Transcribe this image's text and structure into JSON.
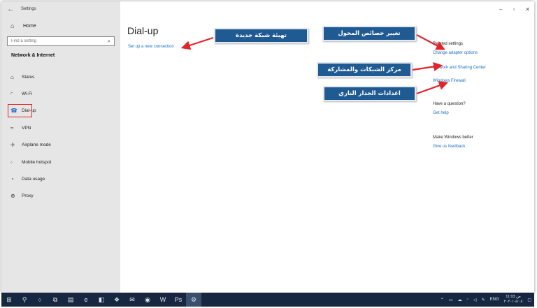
{
  "window": {
    "title": "Settings",
    "back_icon": "back-arrow-icon"
  },
  "sidebar": {
    "home": "Home",
    "search_placeholder": "Find a setting",
    "section": "Network & Internet",
    "items": [
      {
        "label": "Status",
        "icon": "status-icon",
        "glyph": "⌂"
      },
      {
        "label": "Wi-Fi",
        "icon": "wifi-icon",
        "glyph": "◜"
      },
      {
        "label": "Dial-up",
        "icon": "dialup-icon",
        "glyph": "☎",
        "selected": true
      },
      {
        "label": "VPN",
        "icon": "vpn-icon",
        "glyph": "≈"
      },
      {
        "label": "Airplane mode",
        "icon": "airplane-icon",
        "glyph": "✈"
      },
      {
        "label": "Mobile hotspot",
        "icon": "hotspot-icon",
        "glyph": "◦"
      },
      {
        "label": "Data usage",
        "icon": "data-usage-icon",
        "glyph": "◔"
      },
      {
        "label": "Proxy",
        "icon": "proxy-icon",
        "glyph": "⊕"
      }
    ]
  },
  "main": {
    "title": "Dial-up",
    "setup_link": "Set up a new connection"
  },
  "related": {
    "heading": "Related settings",
    "links": [
      "Change adapter options",
      "Network and Sharing Center",
      "Windows Firewall"
    ],
    "question_heading": "Have a question?",
    "help_link": "Get help",
    "better_heading": "Make Windows better",
    "feedback_link": "Give us feedback"
  },
  "callouts": {
    "new_connection": "تهيئة شبكة جديدة",
    "adapter": "تغيير خصائص المحول",
    "sharing_center": "مركز الشبكات والمشاركة",
    "firewall": "اعدادات الجدار الناري"
  },
  "taskbar": {
    "language": "ENG",
    "time": "11:03 ص",
    "date": "٢٠٢٠/٠٤/٠٨"
  },
  "colors": {
    "accent": "#1b6fc1",
    "callout_bg": "#1f5a93",
    "arrow": "#e0262b",
    "taskbar": "#182741",
    "selected_box": "#e0262b"
  }
}
